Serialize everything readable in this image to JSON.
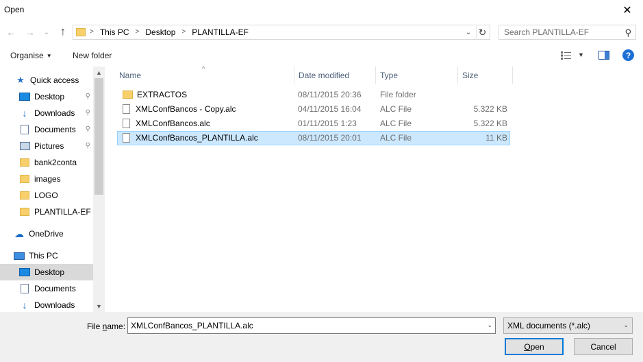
{
  "window": {
    "title": "Open",
    "close_glyph": "✕"
  },
  "nav": {
    "back_glyph": "←",
    "forward_glyph": "→",
    "recent_glyph": "⌄",
    "up_glyph": "↑",
    "breadcrumbs": [
      "This PC",
      "Desktop",
      "PLANTILLA-EF"
    ],
    "crumb_sep": ">",
    "dropdown_glyph": "⌄",
    "refresh_glyph": "↻",
    "search_placeholder": "Search PLANTILLA-EF",
    "search_glyph": "⚲"
  },
  "toolbar": {
    "organise_label": "Organise",
    "caret": "▼",
    "new_folder_label": "New folder",
    "view_caret": "▼",
    "help_label": "?"
  },
  "sidebar": {
    "items": [
      {
        "label": "Quick access",
        "icon": "star-icon",
        "pinned": false,
        "selected": false
      },
      {
        "label": "Desktop",
        "icon": "desktop-icon",
        "pinned": true,
        "selected": false
      },
      {
        "label": "Downloads",
        "icon": "download-icon",
        "pinned": true,
        "selected": false
      },
      {
        "label": "Documents",
        "icon": "document-icon",
        "pinned": true,
        "selected": false
      },
      {
        "label": "Pictures",
        "icon": "pictures-icon",
        "pinned": true,
        "selected": false
      },
      {
        "label": "bank2conta",
        "icon": "folder-icon",
        "pinned": false,
        "selected": false
      },
      {
        "label": "images",
        "icon": "folder-icon",
        "pinned": false,
        "selected": false
      },
      {
        "label": "LOGO",
        "icon": "folder-icon",
        "pinned": false,
        "selected": false
      },
      {
        "label": "PLANTILLA-EF",
        "icon": "folder-icon",
        "pinned": false,
        "selected": false
      },
      {
        "label": "OneDrive",
        "icon": "cloud-icon",
        "pinned": false,
        "selected": false
      },
      {
        "label": "This PC",
        "icon": "computer-icon",
        "pinned": false,
        "selected": false
      },
      {
        "label": "Desktop",
        "icon": "desktop-icon",
        "pinned": false,
        "selected": true
      },
      {
        "label": "Documents",
        "icon": "document-icon",
        "pinned": false,
        "selected": false
      },
      {
        "label": "Downloads",
        "icon": "download-icon",
        "pinned": false,
        "selected": false
      }
    ],
    "pin_glyph": "📌",
    "scroll_up_glyph": "▲",
    "scroll_down_glyph": "▼"
  },
  "columns": {
    "name": "Name",
    "date": "Date modified",
    "type": "Type",
    "size": "Size",
    "sort_glyph": "^"
  },
  "files": [
    {
      "name": "EXTRACTOS",
      "date": "08/11/2015 20:36",
      "type": "File folder",
      "size": "",
      "kind": "folder",
      "selected": false
    },
    {
      "name": "XMLConfBancos - Copy.alc",
      "date": "04/11/2015 16:04",
      "type": "ALC File",
      "size": "5.322 KB",
      "kind": "file",
      "selected": false
    },
    {
      "name": "XMLConfBancos.alc",
      "date": "01/11/2015 1:23",
      "type": "ALC File",
      "size": "5.322 KB",
      "kind": "file",
      "selected": false
    },
    {
      "name": "XMLConfBancos_PLANTILLA.alc",
      "date": "08/11/2015 20:01",
      "type": "ALC File",
      "size": "11 KB",
      "kind": "file",
      "selected": true
    }
  ],
  "footer": {
    "file_name_label_pre": "File ",
    "file_name_label_u": "n",
    "file_name_label_post": "ame:",
    "file_name_value": "XMLConfBancos_PLANTILLA.alc",
    "dropdown_glyph": "⌄",
    "file_type_value": "XML documents (*.alc)",
    "open_label_u": "O",
    "open_label_rest": "pen",
    "cancel_label": "Cancel"
  }
}
